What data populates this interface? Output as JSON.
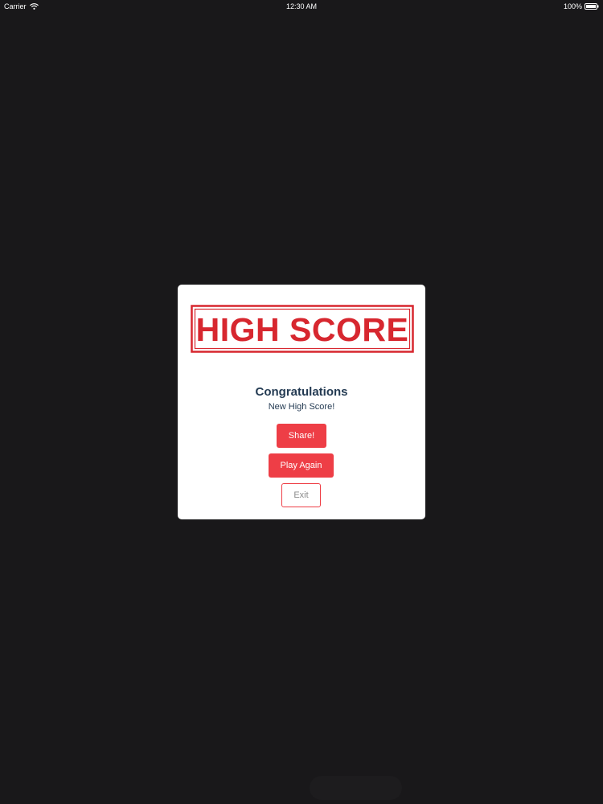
{
  "status_bar": {
    "carrier": "Carrier",
    "time": "12:30 AM",
    "battery": "100%",
    "wifi_icon": "wifi-icon",
    "battery_icon": "battery-icon"
  },
  "dialog": {
    "stamp_text": "HIGH SCORE",
    "title": "Congratulations",
    "subtitle": "New High Score!",
    "buttons": {
      "share": "Share!",
      "play_again": "Play Again",
      "exit": "Exit"
    }
  },
  "colors": {
    "background": "#19181a",
    "accent": "#ee3e46",
    "stamp": "#d7272f",
    "title": "#243b53"
  }
}
